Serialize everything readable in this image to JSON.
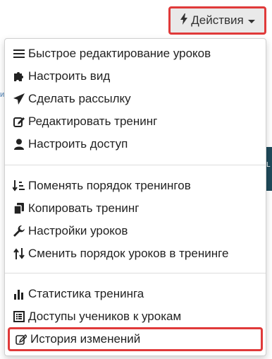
{
  "background": {
    "left_text": "ия",
    "right_text": "L"
  },
  "actions_button": {
    "label": "Действия",
    "icon": "bolt-icon",
    "highlight_color": "#e03a3a"
  },
  "menu": {
    "groups": [
      {
        "items": [
          {
            "label": "Быстрое редактирование уроков",
            "icon": "list-icon"
          },
          {
            "label": "Настроить вид",
            "icon": "puzzle-icon"
          },
          {
            "label": "Сделать рассылку",
            "icon": "paper-plane-icon"
          },
          {
            "label": "Редактировать тренинг",
            "icon": "edit-icon"
          },
          {
            "label": "Настроить доступ",
            "icon": "user-icon"
          }
        ]
      },
      {
        "items": [
          {
            "label": "Поменять порядок тренингов",
            "icon": "sort-list-icon"
          },
          {
            "label": "Копировать тренинг",
            "icon": "copy-icon"
          },
          {
            "label": "Настройки уроков",
            "icon": "wrench-icon"
          },
          {
            "label": "Сменить порядок уроков в тренинге",
            "icon": "sort-arrows-icon"
          }
        ]
      },
      {
        "items": [
          {
            "label": "Статистика тренинга",
            "icon": "bar-chart-icon"
          },
          {
            "label": "Доступы учеников к урокам",
            "icon": "table-list-icon"
          },
          {
            "label": "История изменений",
            "icon": "edit-outline-icon"
          }
        ]
      }
    ]
  }
}
